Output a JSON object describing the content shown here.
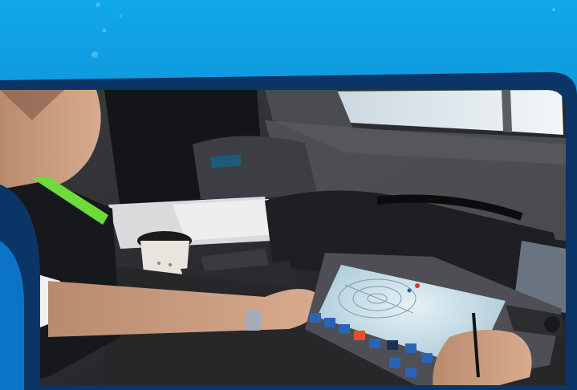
{
  "scene": {
    "colors": {
      "banner_top": "#0fa3e4",
      "banner_bottom": "#0a66b8",
      "frame": "#0a3566",
      "cabin_dark": "#1b1d22",
      "screen_glow": "#cfe4ee",
      "window_light": "#e8eef2"
    },
    "screen_icons": [
      "settings-icon",
      "grid-icon",
      "people-icon",
      "warning-icon",
      "image-icon",
      "layers-icon",
      "cursor-icon",
      "frame-icon",
      "back-icon",
      "chart-icon"
    ]
  }
}
